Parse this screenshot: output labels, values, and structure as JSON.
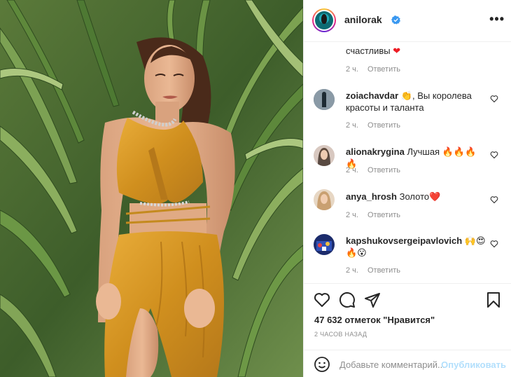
{
  "post": {
    "username": "anilorak",
    "more_icon": "more-horizontal-icon"
  },
  "comments": [
    {
      "user": "",
      "text": "счастливы",
      "emoji": "❤️",
      "time": "2 ч.",
      "reply": "Ответить"
    },
    {
      "user": "zoiachavdar",
      "text": "👏, Вы королева красоты и таланта",
      "time": "2 ч.",
      "reply": "Ответить"
    },
    {
      "user": "alionakrygina",
      "text": "Лучшая 🔥🔥🔥🔥",
      "time": "2 ч.",
      "reply": "Ответить"
    },
    {
      "user": "anya_hrosh",
      "text": "Золото❤️",
      "time": "2 ч.",
      "reply": "Ответить"
    },
    {
      "user": "kapshukovsergeipavlovich",
      "text": "🙌😍🔥😮",
      "time": "2 ч.",
      "reply": "Ответить"
    }
  ],
  "actions": {
    "likes": "47 632 отметок \"Нравится\"",
    "time_ago": "2 ЧАСОВ НАЗАД"
  },
  "add_comment": {
    "placeholder": "Добавьте комментарий...",
    "publish_label": "Опубликовать"
  },
  "colors": {
    "accent": "#0095f6",
    "publish_disabled": "#b2dffc",
    "heart_red": "#ed4956",
    "dress": "#d79a2a"
  }
}
